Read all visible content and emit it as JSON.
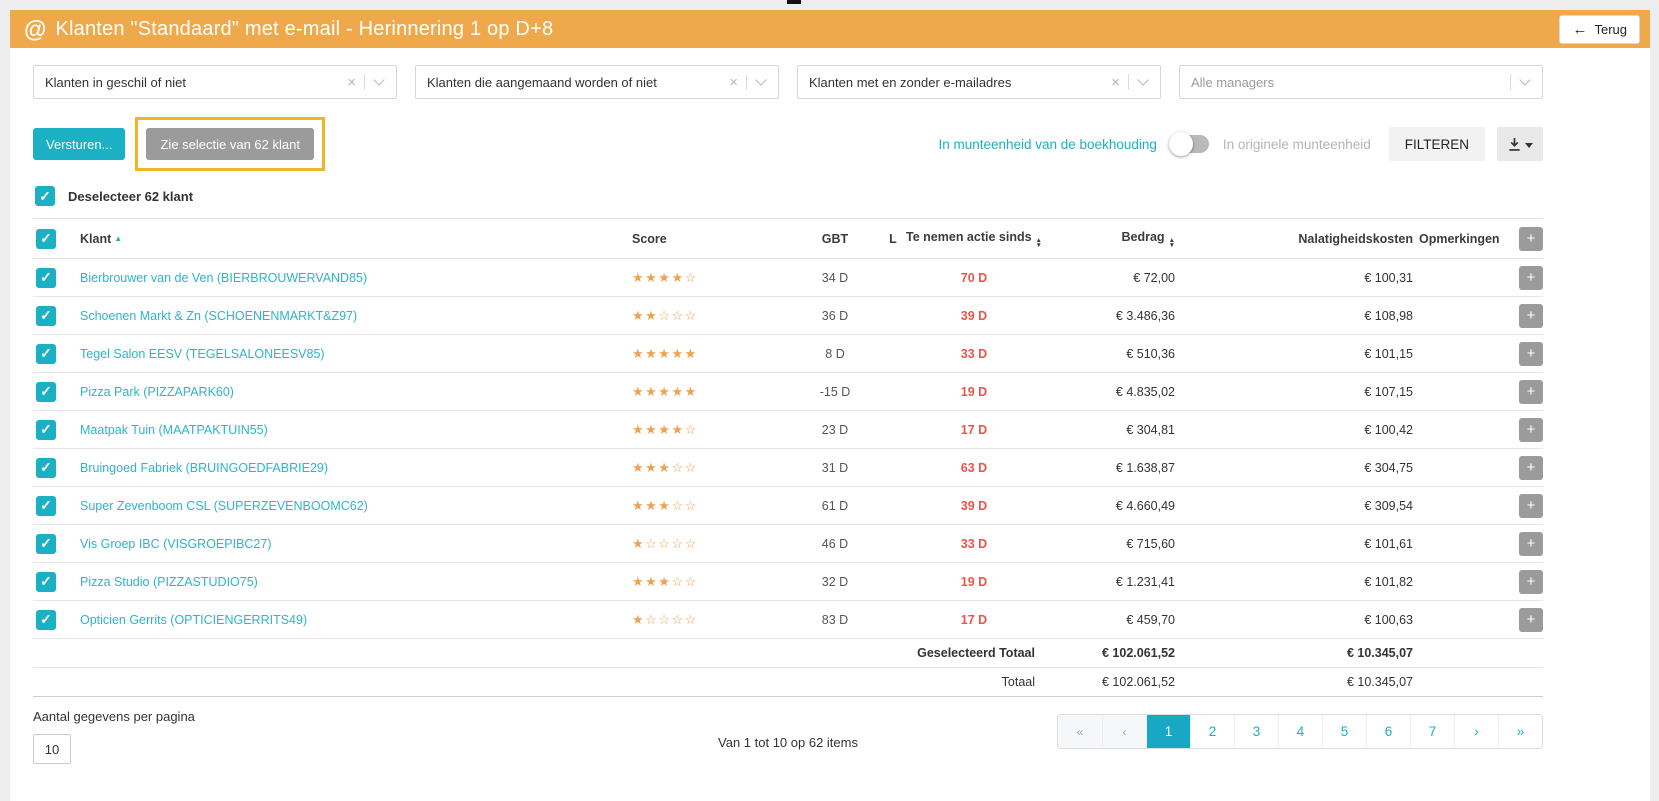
{
  "header": {
    "at_icon": "@",
    "title": "Klanten \"Standaard\" met e-mail - Herinnering 1 op D+8",
    "back_arrow": "←",
    "back_label": "Terug"
  },
  "filters": [
    {
      "value": "Klanten in geschil of niet"
    },
    {
      "value": "Klanten die aangemaand worden of niet"
    },
    {
      "value": "Klanten met en zonder e-mailadres"
    },
    {
      "value": "Alle managers"
    }
  ],
  "toolbar": {
    "send_label": "Versturen...",
    "selection_label": "Zie selectie van 62 klant",
    "currency_accounting_label": "In munteenheid van de boekhouding",
    "currency_original_label": "In originele munteenheid",
    "filter_label": "FILTEREN"
  },
  "select_all": {
    "label": "Deselecteer 62 klant",
    "check": "✓"
  },
  "table": {
    "headers": {
      "klant": "Klant",
      "score": "Score",
      "gbt": "GBT",
      "l": "L",
      "action": "Te nemen actie sinds",
      "amount": "Bedrag",
      "fee": "Nalatigheidskosten",
      "remarks": "Opmerkingen",
      "add": "+"
    },
    "rows": [
      {
        "name": "Bierbrouwer van de Ven (BIERBROUWERVAND85)",
        "stars": 4,
        "gbt": "34 D",
        "action": "70 D",
        "amount": "€ 72,00",
        "fee": "€ 100,31"
      },
      {
        "name": "Schoenen Markt & Zn (SCHOENENMARKT&Z97)",
        "stars": 2,
        "gbt": "36 D",
        "action": "39 D",
        "amount": "€ 3.486,36",
        "fee": "€ 108,98"
      },
      {
        "name": "Tegel Salon EESV (TEGELSALONEESV85)",
        "stars": 5,
        "gbt": "8 D",
        "action": "33 D",
        "amount": "€ 510,36",
        "fee": "€ 101,15"
      },
      {
        "name": "Pizza Park (PIZZAPARK60)",
        "stars": 5,
        "gbt": "-15 D",
        "action": "19 D",
        "amount": "€ 4.835,02",
        "fee": "€ 107,15"
      },
      {
        "name": "Maatpak Tuin (MAATPAKTUIN55)",
        "stars": 4,
        "gbt": "23 D",
        "action": "17 D",
        "amount": "€ 304,81",
        "fee": "€ 100,42"
      },
      {
        "name": "Bruingoed Fabriek (BRUINGOEDFABRIE29)",
        "stars": 3,
        "gbt": "31 D",
        "action": "63 D",
        "amount": "€ 1.638,87",
        "fee": "€ 304,75"
      },
      {
        "name": "Super Zevenboom CSL (SUPERZEVENBOOMC62)",
        "stars": 3,
        "gbt": "61 D",
        "action": "39 D",
        "amount": "€ 4.660,49",
        "fee": "€ 309,54"
      },
      {
        "name": "Vis Groep IBC (VISGROEPIBC27)",
        "stars": 1,
        "gbt": "46 D",
        "action": "33 D",
        "amount": "€ 715,60",
        "fee": "€ 101,61"
      },
      {
        "name": "Pizza Studio (PIZZASTUDIO75)",
        "stars": 3,
        "gbt": "32 D",
        "action": "19 D",
        "amount": "€ 1.231,41",
        "fee": "€ 101,82"
      },
      {
        "name": "Opticien Gerrits (OPTICIENGERRITS49)",
        "stars": 1,
        "gbt": "83 D",
        "action": "17 D",
        "amount": "€ 459,70",
        "fee": "€ 100,63"
      }
    ],
    "selected_total": {
      "label": "Geselecteerd Totaal",
      "amount": "€ 102.061,52",
      "fee": "€ 10.345,07"
    },
    "total": {
      "label": "Totaal",
      "amount": "€ 102.061,52",
      "fee": "€ 10.345,07"
    }
  },
  "footer": {
    "per_page_label": "Aantal gegevens per pagina",
    "per_page_value": "10",
    "range_label": "Van 1 tot 10 op 62 items",
    "pagination": [
      {
        "label": "«",
        "kind": "edge"
      },
      {
        "label": "‹",
        "kind": "edge"
      },
      {
        "label": "1",
        "kind": "page",
        "active": true
      },
      {
        "label": "2",
        "kind": "page"
      },
      {
        "label": "3",
        "kind": "page"
      },
      {
        "label": "4",
        "kind": "page"
      },
      {
        "label": "5",
        "kind": "page"
      },
      {
        "label": "6",
        "kind": "page"
      },
      {
        "label": "7",
        "kind": "page"
      },
      {
        "label": "›",
        "kind": "page"
      },
      {
        "label": "»",
        "kind": "page"
      }
    ]
  },
  "colors": {
    "header_orange": "#efa94a",
    "accent_teal": "#1cb0c4",
    "link_teal": "#2fb4c9",
    "overdue_red": "#e8564b",
    "star_orange": "#f0a14f",
    "annotation_yellow": "#f0b429",
    "gray_button": "#9b9b9b"
  }
}
